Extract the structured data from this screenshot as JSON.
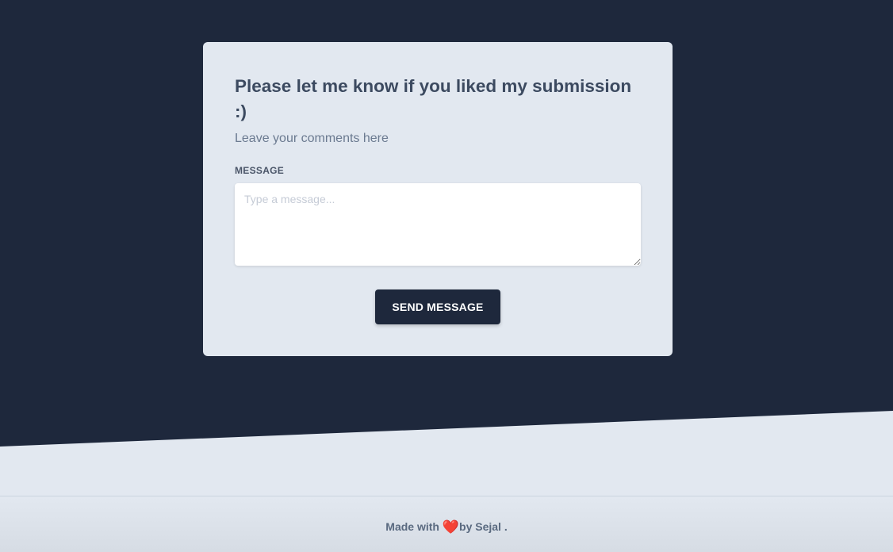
{
  "colors": {
    "hero_background": "#1e283c",
    "page_background": "#e2e8f0",
    "card_background": "#e2e8f0",
    "button_background": "#1e283c",
    "heart": "#e0201a"
  },
  "card": {
    "title": "Please let me know if you liked my submission :)",
    "subtitle": "Leave your comments here",
    "message_label": "MESSAGE",
    "message_placeholder": "Type a message...",
    "message_value": "",
    "send_label": "SEND MESSAGE"
  },
  "footer": {
    "prefix": "Made with ",
    "heart_icon": "heart-icon",
    "heart_glyph": "❤️",
    "suffix": "by Sejal ."
  }
}
